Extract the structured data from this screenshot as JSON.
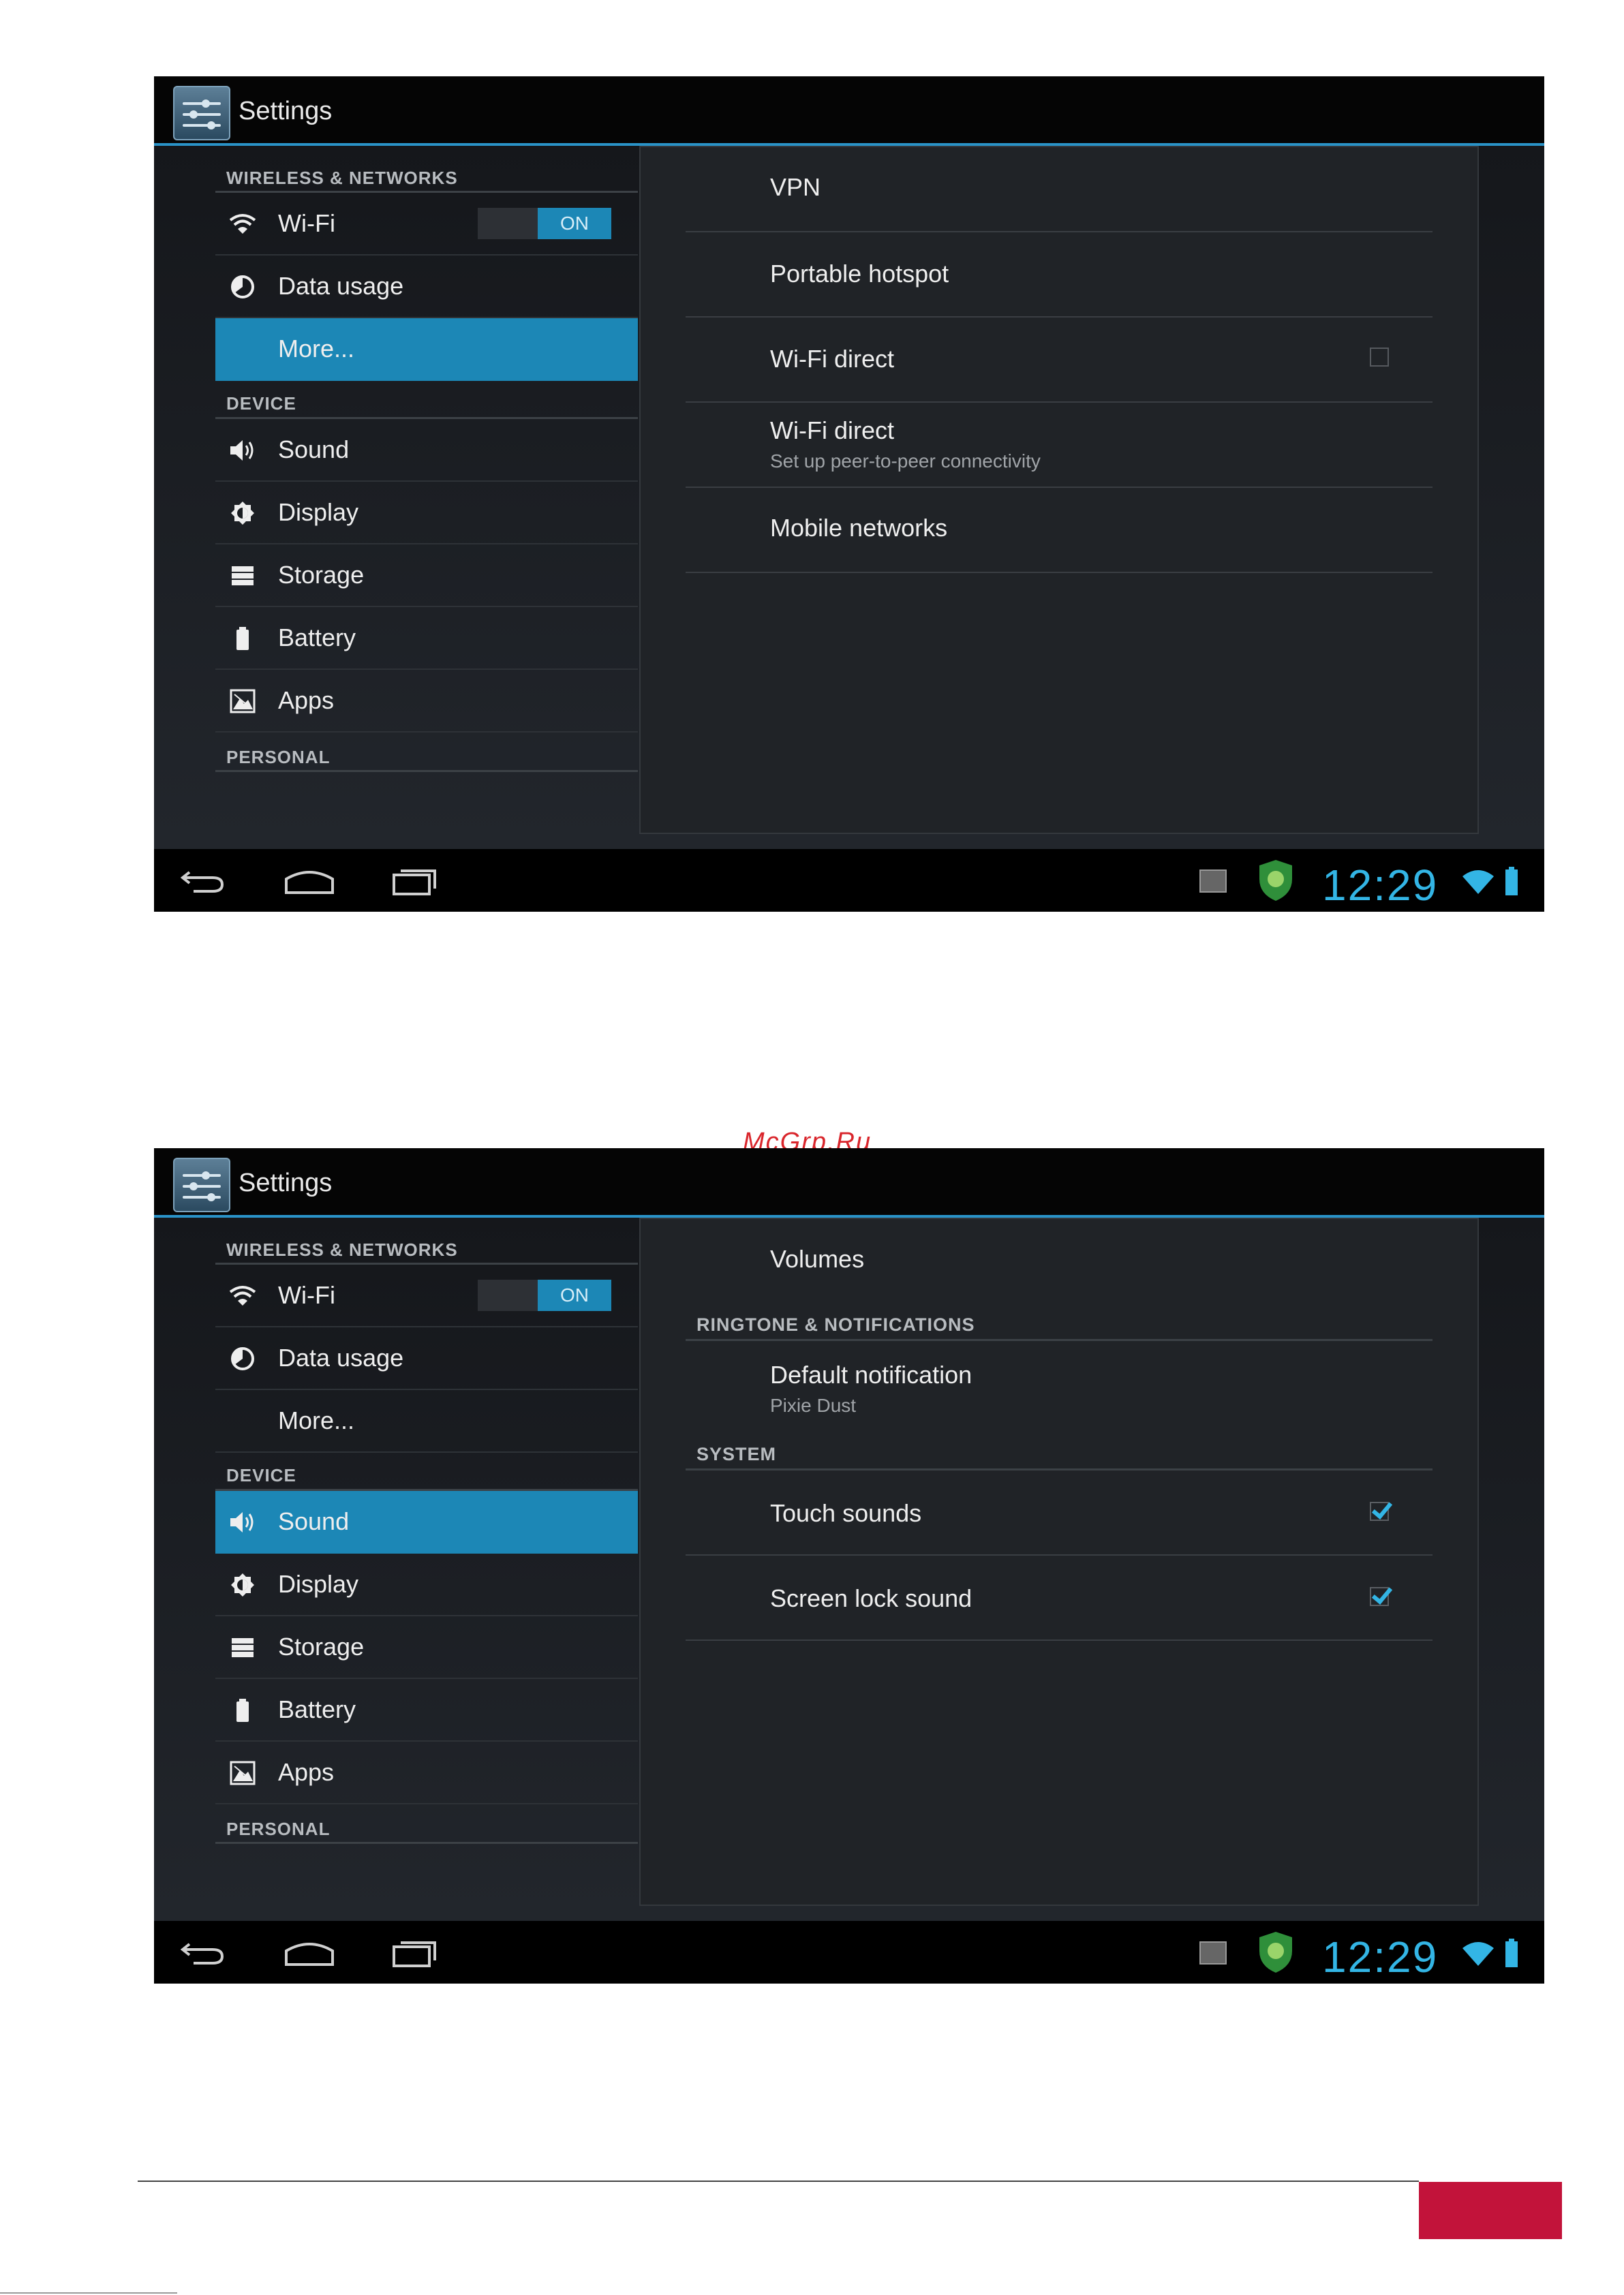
{
  "screens": [
    {
      "title": "Settings",
      "sidebar": {
        "wireless_header": "WIRELESS & NETWORKS",
        "wifi": {
          "label": "Wi-Fi",
          "toggle": "ON"
        },
        "data_usage": "Data usage",
        "more": "More...",
        "device_header": "DEVICE",
        "sound": "Sound",
        "display": "Display",
        "storage": "Storage",
        "battery": "Battery",
        "apps": "Apps",
        "personal_header": "PERSONAL",
        "selected": "More..."
      },
      "panel": {
        "vpn": "VPN",
        "hotspot": "Portable hotspot",
        "wifi_direct": "Wi-Fi direct",
        "wifi_direct2": {
          "title": "Wi-Fi direct",
          "subtitle": "Set up peer-to-peer connectivity"
        },
        "mobile": "Mobile networks"
      },
      "status": {
        "clock": "12:29"
      }
    },
    {
      "title": "Settings",
      "sidebar": {
        "wireless_header": "WIRELESS & NETWORKS",
        "wifi": {
          "label": "Wi-Fi",
          "toggle": "ON"
        },
        "data_usage": "Data usage",
        "more": "More...",
        "device_header": "DEVICE",
        "sound": "Sound",
        "display": "Display",
        "storage": "Storage",
        "battery": "Battery",
        "apps": "Apps",
        "personal_header": "PERSONAL",
        "selected": "Sound"
      },
      "panel": {
        "volumes": "Volumes",
        "ringtone_header": "RINGTONE & NOTIFICATIONS",
        "default_notification": {
          "title": "Default notification",
          "subtitle": "Pixie Dust"
        },
        "system_header": "SYSTEM",
        "touch_sounds": {
          "label": "Touch sounds",
          "checked": true
        },
        "screen_lock": {
          "label": "Screen lock sound",
          "checked": true
        }
      },
      "status": {
        "clock": "12:29"
      }
    }
  ],
  "watermark": "McGrp.Ru",
  "colors": {
    "accent": "#33b5e5",
    "selected": "#1c87b6",
    "brand": "#c2133a"
  }
}
